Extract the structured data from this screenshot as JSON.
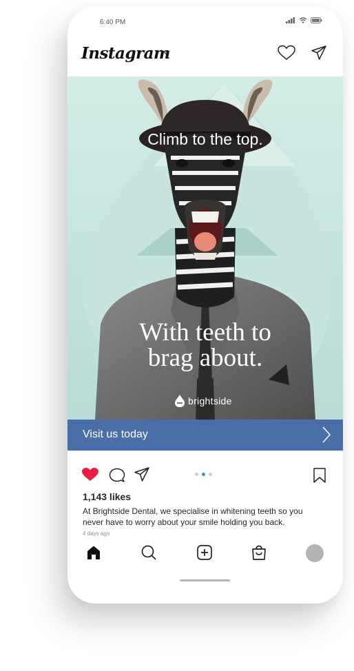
{
  "status_bar": {
    "time": "6:40 PM",
    "signal_icon": "signal-icon",
    "wifi_icon": "wifi-icon",
    "battery_icon": "battery-icon"
  },
  "header": {
    "app_name": "Instagram",
    "switch_icon": "chevron-down-icon",
    "activity_icon": "heart-icon",
    "direct_icon": "paper-plane-icon"
  },
  "post": {
    "image": {
      "headline": "Climb to the top.",
      "tagline_line1": "With teeth to",
      "tagline_line2": "brag about.",
      "brand": "brightside",
      "subject": "zebra-in-suit-image"
    },
    "cta": {
      "label": "Visit us today",
      "icon": "chevron-right-icon"
    },
    "actions": {
      "like_icon": "heart-filled-icon",
      "comment_icon": "comment-icon",
      "share_icon": "paper-plane-icon",
      "save_icon": "bookmark-icon"
    },
    "carousel": {
      "count": 3,
      "active": 2
    },
    "likes": "1,143 likes",
    "caption": "At Brightside Dental, we specialise in whitening teeth so you never have to worry about your smile holding you back.",
    "time_ago": "4 days ago"
  },
  "bottom_nav": [
    "home-icon",
    "search-icon",
    "new-post-icon",
    "shop-icon",
    "profile-avatar"
  ],
  "colors": {
    "cta": "#4a6ea8",
    "like": "#ed1c45",
    "poster_bg": "#cfe9e3",
    "carousel_active": "#3b8be0"
  }
}
